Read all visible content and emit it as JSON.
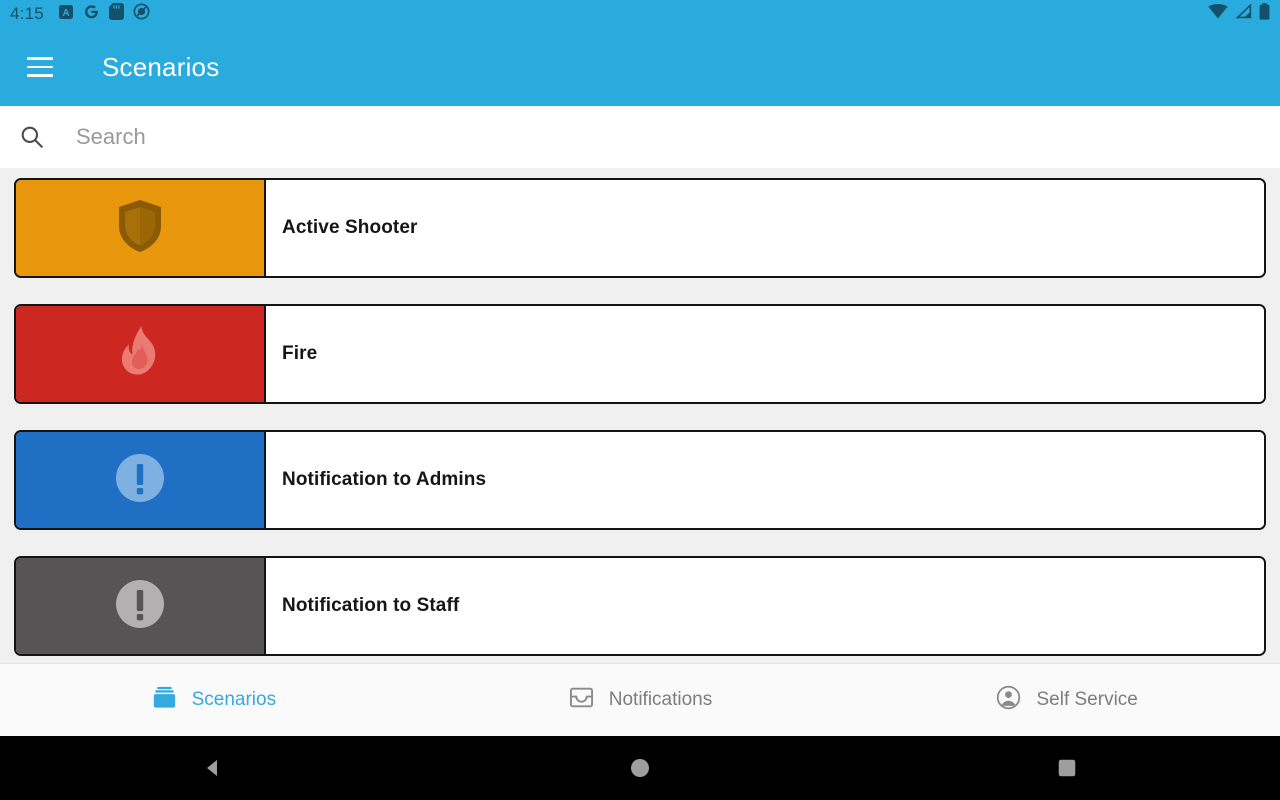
{
  "status_bar": {
    "time": "4:15",
    "left_icons": [
      "a-badge-icon",
      "google-g-icon",
      "sd-card-icon",
      "do-not-disturb-icon"
    ],
    "right_icons": [
      "wifi-icon",
      "cell-signal-icon",
      "battery-icon"
    ],
    "background_color": "#29abdd",
    "icon_color": "#15506b"
  },
  "app_bar": {
    "menu_icon": "hamburger-menu-icon",
    "title": "Scenarios",
    "background_color": "#29abdd",
    "title_color": "#ffffff"
  },
  "search": {
    "icon": "search-icon",
    "placeholder": "Search",
    "value": ""
  },
  "scenarios": [
    {
      "label": "Active Shooter",
      "icon": "shield-icon",
      "panel_color": "#e8960c",
      "icon_color": "#8a5a05"
    },
    {
      "label": "Fire",
      "icon": "flame-icon",
      "panel_color": "#cc2720",
      "icon_color": "#ea7a72"
    },
    {
      "label": "Notification to Admins",
      "icon": "exclamation-circle-icon",
      "panel_color": "#1f6fc4",
      "icon_color": "#7fb0e2"
    },
    {
      "label": "Notification to Staff",
      "icon": "exclamation-circle-icon",
      "panel_color": "#565454",
      "icon_color": "#b2b0b0"
    }
  ],
  "bottom_tabs": [
    {
      "label": "Scenarios",
      "icon": "stacked-cards-icon",
      "active": true,
      "color": "#35aadf"
    },
    {
      "label": "Notifications",
      "icon": "inbox-tray-icon",
      "active": false,
      "color": "#7d7d7d"
    },
    {
      "label": "Self Service",
      "icon": "account-circle-icon",
      "active": false,
      "color": "#7d7d7d"
    }
  ],
  "android_nav": {
    "back": "back-triangle-icon",
    "home": "home-circle-icon",
    "recents": "recents-square-icon",
    "background_color": "#000000",
    "icon_color": "#9e9e9e"
  }
}
